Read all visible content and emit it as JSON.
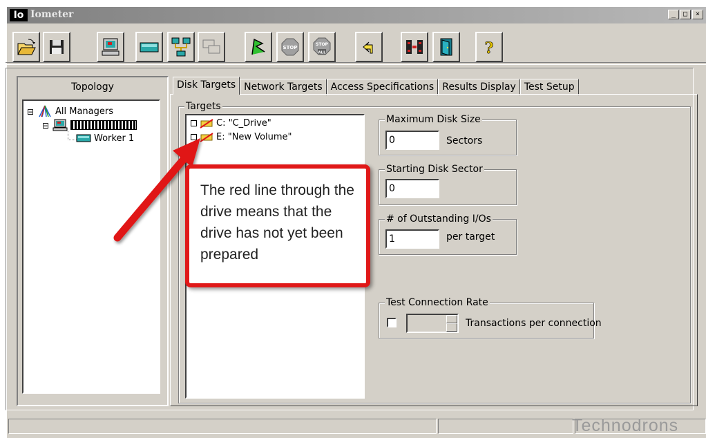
{
  "window": {
    "icon_text": "Io",
    "title": "Iometer",
    "minimize_glyph": "_",
    "maximize_glyph": "□",
    "close_glyph": "×"
  },
  "toolbar": {
    "buttons": [
      {
        "name": "open-icon"
      },
      {
        "name": "save-icon"
      },
      {
        "name": "new-manager-icon"
      },
      {
        "name": "new-disk-worker-icon"
      },
      {
        "name": "new-network-worker-icon"
      },
      {
        "name": "duplicate-worker-icon"
      },
      {
        "name": "start-tests-icon"
      },
      {
        "name": "stop-icon",
        "text": "STOP"
      },
      {
        "name": "stop-all-icon",
        "text1": "STOP",
        "text2": "ALL"
      },
      {
        "name": "reset-workers-icon"
      },
      {
        "name": "disconnect-icon"
      },
      {
        "name": "exit-icon"
      },
      {
        "name": "help-icon",
        "text": "?"
      }
    ]
  },
  "topology": {
    "title": "Topology",
    "root_expander": "⊟",
    "root_label": "All Managers",
    "manager_expander": "⊟",
    "worker_label": "Worker 1"
  },
  "tabs": [
    "Disk Targets",
    "Network Targets",
    "Access Specifications",
    "Results Display",
    "Test Setup"
  ],
  "targets": {
    "group_label": "Targets",
    "items": [
      {
        "label": "C: \"C_Drive\""
      },
      {
        "label": "E: \"New Volume\""
      }
    ]
  },
  "max_disk_size": {
    "label": "Maximum Disk Size",
    "value": "0",
    "unit": "Sectors"
  },
  "starting_disk_sector": {
    "label": "Starting Disk Sector",
    "value": "0"
  },
  "outstanding_ios": {
    "label": "# of Outstanding I/Os",
    "value": "1",
    "unit": "per target"
  },
  "test_connection_rate": {
    "label": "Test Connection Rate",
    "value": "",
    "unit": "Transactions per connection"
  },
  "callout": {
    "text": "The red line through the drive means that the drive has not yet been prepared"
  },
  "watermark": "Technodrons",
  "colors": {
    "callout_red": "#e01818",
    "dialog_gray": "#d4d0c8"
  }
}
